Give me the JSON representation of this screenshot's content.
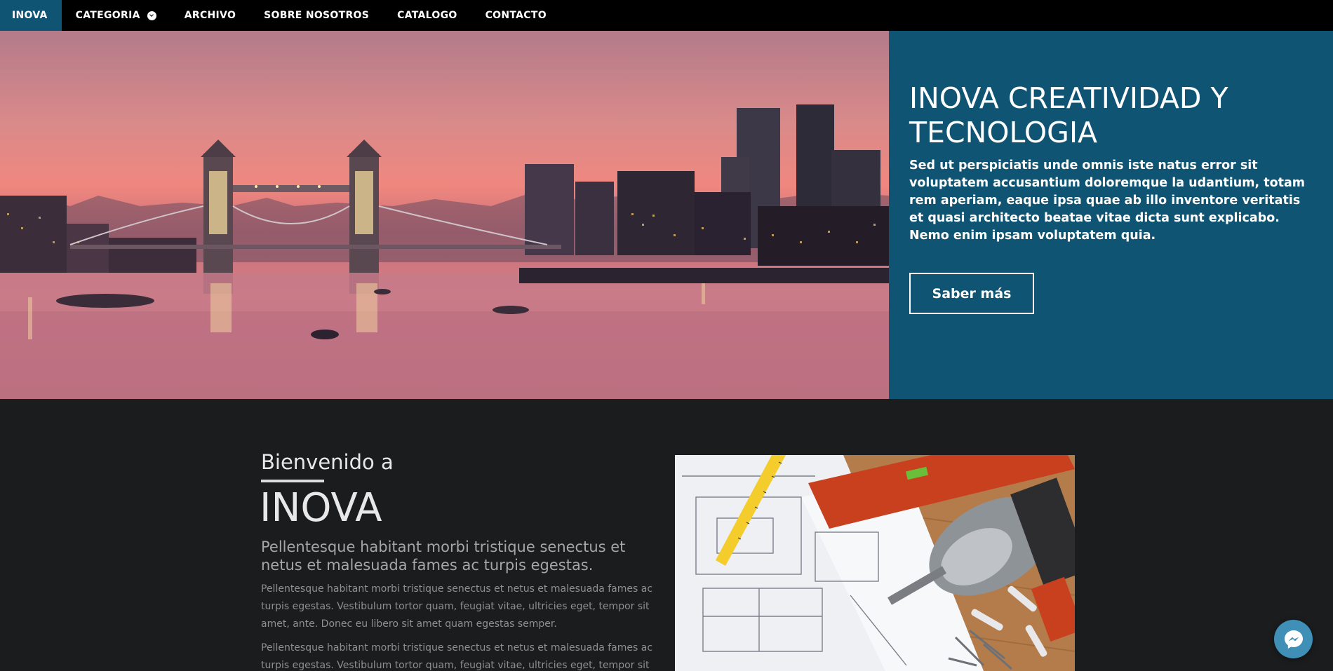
{
  "nav": {
    "items": [
      {
        "label": "INOVA",
        "active": true
      },
      {
        "label": "CATEGORIA",
        "has_dropdown": true
      },
      {
        "label": "ARCHIVO"
      },
      {
        "label": "SOBRE NOSOTROS"
      },
      {
        "label": "CATALOGO"
      },
      {
        "label": "CONTACTO"
      }
    ],
    "active_color": "#0f5573"
  },
  "hero": {
    "title": "INOVA CREATIVIDAD Y TECNOLOGIA",
    "text": "Sed ut perspiciatis unde omnis iste natus error sit voluptatem accusantium doloremque la udantium, totam rem aperiam, eaque ipsa quae ab illo inventore veritatis et quasi architecto beatae vitae dicta sunt explicabo. Nemo enim ipsam voluptatem quia.",
    "button_label": "Saber más",
    "panel_color": "#0f5573",
    "image": "london-tower-bridge-sunset"
  },
  "welcome": {
    "small_title": "Bienvenido a",
    "big_title": "INOVA",
    "lead": "Pellentesque habitant morbi tristique senectus et netus et malesuada fames ac turpis egestas.",
    "paragraph_1": "Pellentesque habitant morbi tristique senectus et netus et malesuada fames ac turpis egestas. Vestibulum tortor quam, feugiat vitae, ultricies eget, tempor sit amet, ante. Donec eu libero sit amet quam egestas semper.",
    "paragraph_2": "Pellentesque habitant morbi tristique senectus et netus et malesuada fames ac turpis egestas. Vestibulum tortor quam, feugiat vitae, ultricies eget, tempor sit",
    "image": "blueprints-and-tools"
  },
  "messenger": {
    "icon": "messenger-icon",
    "color": "#3f8fb6"
  }
}
